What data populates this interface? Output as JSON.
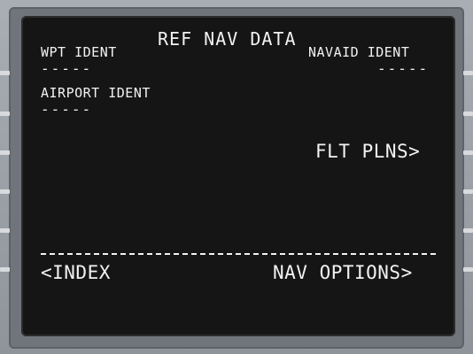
{
  "page": {
    "title": "REF NAV DATA"
  },
  "left": {
    "wpt_ident_label": "WPT IDENT",
    "wpt_ident_value": "-----",
    "airport_ident_label": "AIRPORT IDENT",
    "airport_ident_value": "-----",
    "index_prompt": "<INDEX"
  },
  "right": {
    "navaid_ident_label": "NAVAID IDENT",
    "navaid_ident_value": "-----",
    "flt_plns_prompt": "FLT PLNS>",
    "nav_options_prompt": "NAV OPTIONS>"
  },
  "colors": {
    "screen": "#151515",
    "text": "#f2f2f2",
    "bezel": "#70757c"
  }
}
